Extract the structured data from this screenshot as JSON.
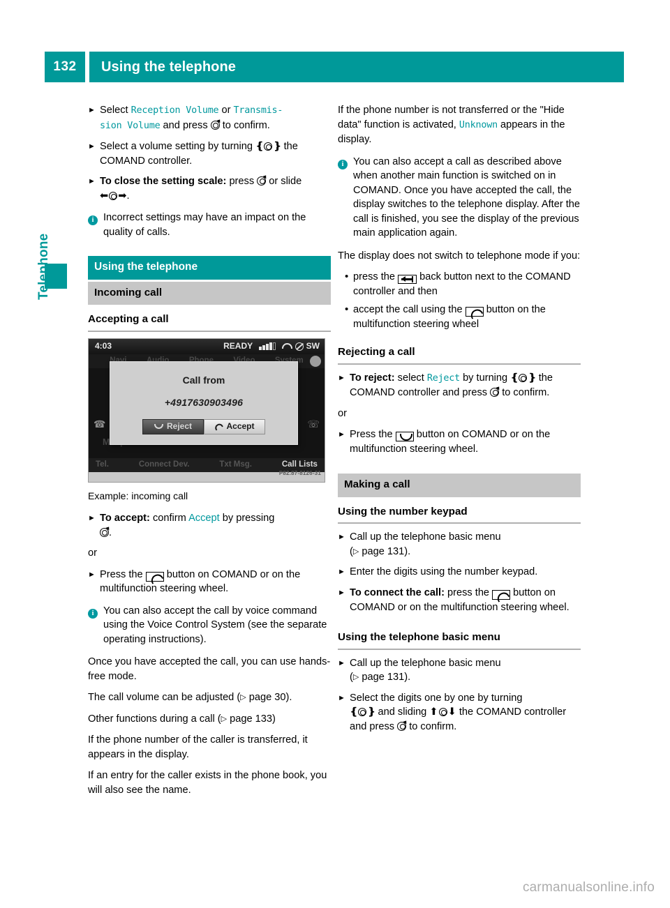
{
  "header": {
    "page_number": "132",
    "title": "Using the telephone"
  },
  "side_tab": {
    "label": "Telephone"
  },
  "colors": {
    "teal": "#009999",
    "screen_text_teal": "#00989e",
    "grey_bar": "#c6c6c6"
  },
  "left_column": {
    "step1": {
      "prefix": "Select ",
      "term1": "Reception Volume",
      "joiner": " or ",
      "term2": "Transmis‐",
      "term2b": "sion Volume",
      "mid": " and press ",
      "suffix": " to confirm."
    },
    "step2": {
      "prefix": "Select a volume setting by turning ",
      "suffix": " the COMAND controller."
    },
    "step3": {
      "bold": "To close the setting scale:",
      "mid": " press ",
      "or": " or slide ",
      "end": "."
    },
    "note1": "Incorrect settings may have an impact on the quality of calls.",
    "section_bar": "Using the telephone",
    "sub_bar": "Incoming call",
    "heading_accepting": "Accepting a call",
    "caption": "Example: incoming call",
    "step_accept": {
      "bold": "To accept:",
      "mid": " confirm ",
      "term": "Accept",
      "suffix": " by pressing ",
      "end": "."
    },
    "or_1": "or",
    "step_press_phone": {
      "prefix": "Press the ",
      "suffix": " button on COMAND or on the multifunction steering wheel."
    },
    "note2": "You can also accept the call by voice command using the Voice Control System (see the separate operating instructions).",
    "para_handsfree": "Once you have accepted the call, you can use hands-free mode.",
    "para_volume": {
      "prefix": "The call volume can be adjusted (",
      "page": " page 30).",
      "arrow": "▷"
    },
    "para_other": {
      "prefix": "Other functions during a call (",
      "page": " page 133)",
      "arrow": "▷"
    },
    "para_transferred": "If the phone number of the caller is transferred, it appears in the display.",
    "para_phonebook": "If an entry for the caller exists in the phone book, you will also see the name."
  },
  "comand_screenshot": {
    "clock": "4:03",
    "status_ready": "READY",
    "status_network": "SW",
    "menu_items": [
      "Navi",
      "Audio",
      "Phone",
      "Video",
      "System"
    ],
    "dialog_title": "Call from",
    "dialog_number": "+4917630903496",
    "dialog_reject": "Reject",
    "dialog_accept": "Accept",
    "device_name": "MzXperia Arc S",
    "bottom_bar": [
      "Tel.",
      "Connect Dev.",
      "Txt Msg.",
      "Call Lists"
    ],
    "image_code": "P82.87-8126-31"
  },
  "right_column": {
    "para_unknown": {
      "prefix": "If the phone number is not transferred or the \"Hide data\" function is activated, ",
      "term": "Unknown",
      "suffix": " appears in the display."
    },
    "note_accept": "You can also accept a call as described above when another main function is switched on in COMAND. Once you have accepted the call, the display switches to the telephone display. After the call is finished, you see the display of the previous main application again.",
    "para_noswitch": "The display does not switch to telephone mode if you:",
    "bullet_back": {
      "prefix": "press the ",
      "suffix": " back button next to the COMAND controller and then"
    },
    "bullet_accept": {
      "prefix": "accept the call using the ",
      "suffix": " button on the multifunction steering wheel"
    },
    "heading_rejecting": "Rejecting a call",
    "step_reject": {
      "bold": "To reject:",
      "mid": " select ",
      "term": "Reject",
      "mid2": " by turning ",
      "mid3": " the COMAND controller and press ",
      "end": " to confirm."
    },
    "or_2": "or",
    "step_press_hangup": {
      "prefix": "Press the ",
      "suffix": " button on COMAND or on the multifunction steering wheel."
    },
    "bar_making": "Making a call",
    "heading_keypad": "Using the number keypad",
    "step_callup_1": {
      "line1": "Call up the telephone basic menu",
      "line2": " page 131).",
      "arrow": "▷"
    },
    "step_enter": "Enter the digits using the number keypad.",
    "step_connect": {
      "bold": "To connect the call:",
      "mid": " press the ",
      "suffix": " button on COMAND or on the multifunction steering wheel."
    },
    "heading_basic_menu": "Using the telephone basic menu",
    "step_callup_2": {
      "line1": "Call up the telephone basic menu",
      "line2": " page 131).",
      "arrow": "▷"
    },
    "step_select_digits": {
      "prefix": "Select the digits one by one by turning ",
      "mid": " and sliding ",
      "mid2": " the COMAND controller and press ",
      "end": " to confirm."
    }
  },
  "footer": {
    "watermark": "carmanualsonline.info"
  }
}
